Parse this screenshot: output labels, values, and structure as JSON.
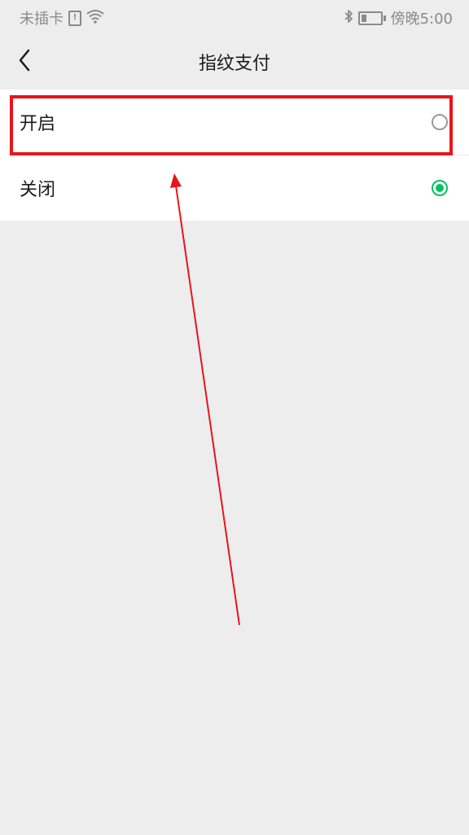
{
  "status_bar": {
    "carrier": "未插卡",
    "sim_mark": "!",
    "time": "傍晚5:00",
    "battery_level": 0.25,
    "icons": [
      "sim-alert-icon",
      "wifi-icon",
      "bluetooth-icon",
      "battery-icon"
    ]
  },
  "header": {
    "title": "指纹支付",
    "back_icon": "chevron-left-icon"
  },
  "options": [
    {
      "label": "开启",
      "selected": false
    },
    {
      "label": "关闭",
      "selected": true
    }
  ],
  "colors": {
    "background": "#ededed",
    "accent_green": "#07c160",
    "annotation_red": "#e8141b",
    "text_primary": "#1a1a1a",
    "status_text": "#8a8a8a"
  }
}
